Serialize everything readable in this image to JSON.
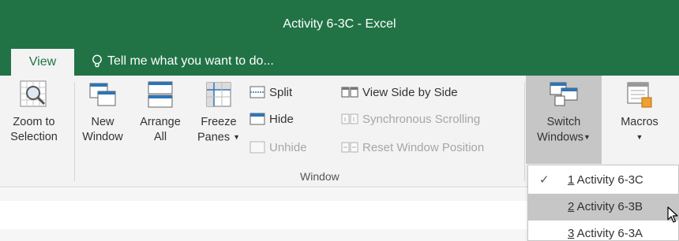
{
  "window": {
    "title": "Activity 6-3C - Excel"
  },
  "tabs": {
    "active": "View"
  },
  "tell_me": {
    "text": "Tell me what you want to do..."
  },
  "ribbon": {
    "zoom_to_selection": {
      "line1": "Zoom to",
      "line2": "Selection"
    },
    "new_window": {
      "line1": "New",
      "line2": "Window"
    },
    "arrange_all": {
      "line1": "Arrange",
      "line2": "All"
    },
    "freeze_panes": {
      "line1": "Freeze",
      "line2": "Panes"
    },
    "split": "Split",
    "hide": "Hide",
    "unhide": "Unhide",
    "view_side_by_side": "View Side by Side",
    "synchronous_scrolling": "Synchronous Scrolling",
    "reset_window_position": "Reset Window Position",
    "group_label": "Window",
    "switch_windows": {
      "line1": "Switch",
      "line2": "Windows"
    },
    "macros": {
      "line1": "Macros"
    }
  },
  "switch_windows_menu": {
    "items": [
      {
        "num": "1",
        "name": " Activity 6-3C",
        "checked": true
      },
      {
        "num": "2",
        "name": " Activity 6-3B",
        "checked": false,
        "hovered": true
      },
      {
        "num": "3",
        "name": " Activity 6-3A",
        "checked": false
      }
    ],
    "check_glyph": "✓"
  },
  "colors": {
    "brand": "#217346",
    "ribbon_bg": "#f3f3f3",
    "highlight": "#c6c6c6"
  }
}
